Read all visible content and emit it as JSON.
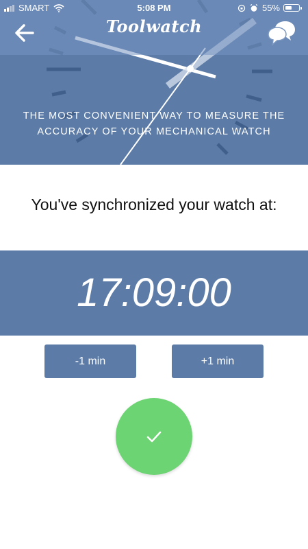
{
  "status_bar": {
    "carrier": "SMART",
    "time": "5:08 PM",
    "battery_percent": "55%",
    "battery_level": 0.55
  },
  "header": {
    "title": "Toolwatch",
    "back_icon": "arrow-left-icon",
    "chat_icon": "chat-bubbles-icon"
  },
  "hero": {
    "tagline": "THE MOST CONVENIENT WAY TO MEASURE THE ACCURACY OF YOUR MECHANICAL WATCH"
  },
  "sync": {
    "message": "You've synchronized your watch at:",
    "time": "17:09:00",
    "minus_label": "-1 min",
    "plus_label": "+1 min",
    "confirm_icon": "checkmark-icon"
  },
  "colors": {
    "primary_blue": "#5c7ba7",
    "confirm_green": "#6dd473",
    "text_dark": "#111111"
  }
}
